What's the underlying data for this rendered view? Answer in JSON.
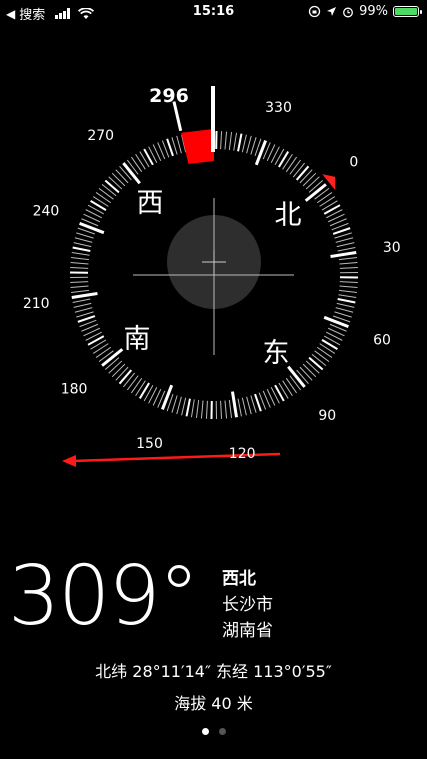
{
  "status_bar": {
    "back_label": "搜索",
    "time": "15:16",
    "battery": "99%",
    "battery_level": 0.99
  },
  "compass": {
    "bearing_marker_label": "296",
    "degree_labels": [
      "0",
      "30",
      "60",
      "90",
      "120",
      "150",
      "180",
      "210",
      "240",
      "270",
      "330"
    ],
    "cardinal": {
      "north": "北",
      "east": "东",
      "south": "南",
      "west": "西"
    },
    "colors": {
      "target": "#ff0000",
      "ring": "#ffffff",
      "background": "#000000"
    }
  },
  "reading": {
    "heading": "309°",
    "direction": "西北",
    "city": "长沙市",
    "province": "湖南省",
    "coordinates": "北纬 28°11′14″  东经 113°0′55″",
    "altitude": "海拔 40 米"
  },
  "pager": {
    "count": 2,
    "active": 0
  }
}
